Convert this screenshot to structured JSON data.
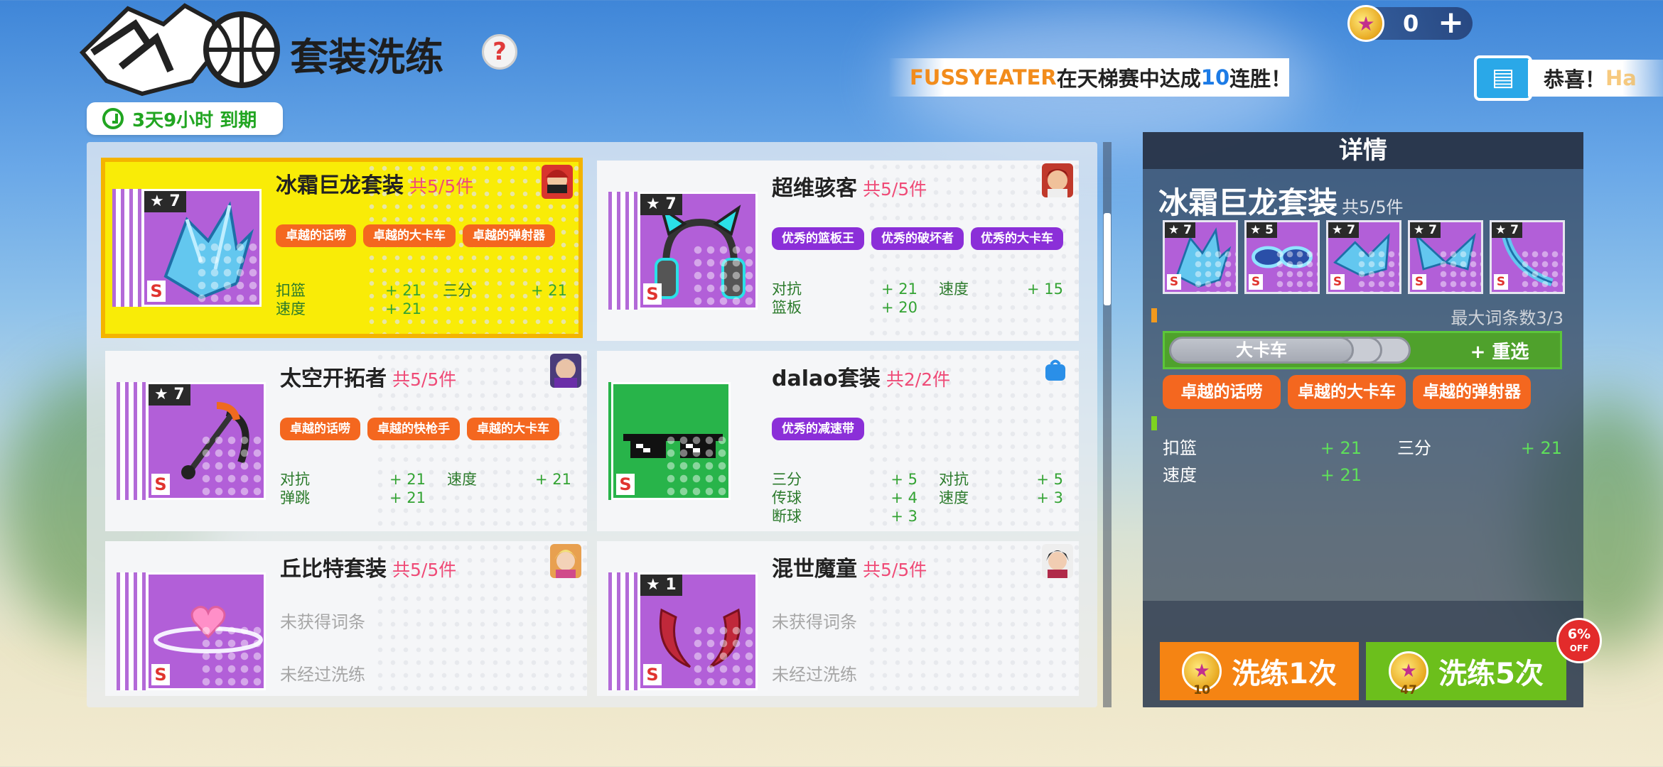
{
  "header": {
    "title": "套装洗练",
    "help_label": "?",
    "timer": "3天9小时 到期",
    "coin_count": "0",
    "add_label": "+",
    "ticker": {
      "prefix": "",
      "name": "FUSSYEATER",
      "mid": "在天梯赛中达成",
      "num": "10",
      "suffix": "连胜！"
    },
    "news": {
      "text": "恭喜！",
      "fade": "Ha"
    }
  },
  "cards": [
    {
      "name": "冰霜巨龙套装",
      "count": "共5/5件",
      "star": "★ 7",
      "grade": "S",
      "tags": [
        "卓越的话唠",
        "卓越的大卡车",
        "卓越的弹射器"
      ],
      "stats": [
        [
          "扣篮",
          "+ 21",
          "三分",
          "+ 21"
        ],
        [
          "速度",
          "+ 21",
          "",
          ""
        ]
      ]
    },
    {
      "name": "超维骇客",
      "count": "共5/5件",
      "star": "★ 7",
      "grade": "S",
      "tags": [
        "优秀的篮板王",
        "优秀的破坏者",
        "优秀的大卡车"
      ],
      "stats": [
        [
          "对抗",
          "+ 21",
          "速度",
          "+ 15"
        ],
        [
          "篮板",
          "+ 20",
          "",
          ""
        ]
      ]
    },
    {
      "name": "太空开拓者",
      "count": "共5/5件",
      "star": "★ 7",
      "grade": "S",
      "tags": [
        "卓越的话唠",
        "卓越的快枪手",
        "卓越的大卡车"
      ],
      "stats": [
        [
          "对抗",
          "+ 21",
          "速度",
          "+ 21"
        ],
        [
          "弹跳",
          "+ 21",
          "",
          ""
        ]
      ]
    },
    {
      "name": "dalao套装",
      "count": "共2/2件",
      "star": "",
      "grade": "S",
      "tags": [
        "优秀的减速带"
      ],
      "stats": [
        [
          "三分",
          "+ 5",
          "对抗",
          "+ 5"
        ],
        [
          "传球",
          "+ 4",
          "速度",
          "+ 3"
        ],
        [
          "断球",
          "+ 3",
          "",
          ""
        ]
      ]
    },
    {
      "name": "丘比特套装",
      "count": "共5/5件",
      "star": "",
      "grade": "S",
      "no_entry": "未获得词条",
      "no_reroll": "未经过洗练"
    },
    {
      "name": "混世魔童",
      "count": "共5/5件",
      "star": "★ 1",
      "grade": "S",
      "no_entry": "未获得词条",
      "no_reroll": "未经过洗练"
    }
  ],
  "detail": {
    "header": "详情",
    "name": "冰霜巨龙套装",
    "count": "共5/5件",
    "items": [
      {
        "star": "★ 7",
        "grade": "S"
      },
      {
        "star": "★ 5",
        "grade": "S"
      },
      {
        "star": "★ 7",
        "grade": "S"
      },
      {
        "star": "★ 7",
        "grade": "S"
      },
      {
        "star": "★ 7",
        "grade": "S"
      }
    ],
    "max_entries": "最大词条数3/3",
    "locked_entry": "大卡车",
    "reroll_label": "+ 重选",
    "tags": [
      "卓越的话唠",
      "卓越的大卡车",
      "卓越的弹射器"
    ],
    "stats": [
      [
        "扣篮",
        "+ 21",
        "三分",
        "+ 21"
      ],
      [
        "速度",
        "+ 21",
        "",
        ""
      ]
    ],
    "btn1": {
      "label": "洗练1次",
      "cost": "10"
    },
    "btn5": {
      "label": "洗练5次",
      "cost": "47"
    },
    "discount": {
      "pct": "6%",
      "word": "OFF"
    }
  },
  "colors": {
    "selected_bg": "#f9ec07",
    "orange_tag": "#f4671f",
    "purple_tag": "#8b2fd8",
    "stat_green": "#33a333"
  }
}
